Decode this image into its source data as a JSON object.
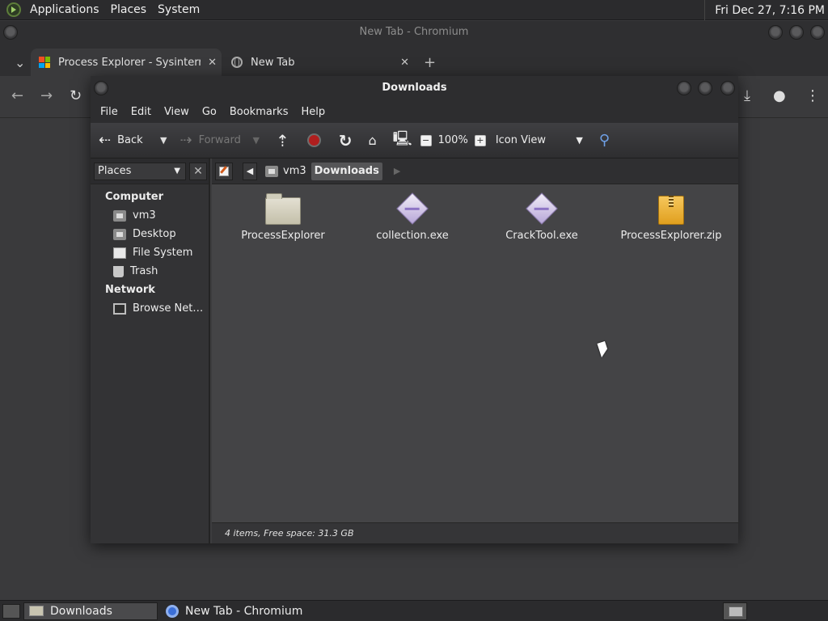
{
  "top_panel": {
    "menus": [
      "Applications",
      "Places",
      "System"
    ],
    "clock": "Fri Dec 27,  7:16 PM"
  },
  "chromium": {
    "window_title": "New Tab - Chromium",
    "tabs": [
      {
        "label": "Process Explorer - Sysinterna",
        "close": "✕",
        "icon": "microsoft-icon"
      },
      {
        "label": "New Tab",
        "close": "✕",
        "icon": "globe-icon"
      }
    ],
    "new_tab": "+",
    "tab_list": "⌄"
  },
  "file_manager": {
    "title": "Downloads",
    "menu": [
      "File",
      "Edit",
      "View",
      "Go",
      "Bookmarks",
      "Help"
    ],
    "toolbar": {
      "back": "Back",
      "forward": "Forward",
      "zoom": "100%",
      "view_mode": "Icon View"
    },
    "sidebar": {
      "selector": "Places",
      "groups": [
        {
          "label": "Computer",
          "items": [
            {
              "label": "vm3",
              "icon": "home-icon"
            },
            {
              "label": "Desktop",
              "icon": "desktop-icon"
            },
            {
              "label": "File System",
              "icon": "filesystem-icon"
            },
            {
              "label": "Trash",
              "icon": "trash-icon"
            }
          ]
        },
        {
          "label": "Network",
          "items": [
            {
              "label": "Browse Net…",
              "icon": "network-icon"
            }
          ]
        }
      ]
    },
    "pathbar": {
      "crumbs": [
        "vm3",
        "Downloads"
      ]
    },
    "files": [
      {
        "name": "ProcessExplorer",
        "type": "folder"
      },
      {
        "name": "collection.exe",
        "type": "exe"
      },
      {
        "name": "CrackTool.exe",
        "type": "exe"
      },
      {
        "name": "ProcessExplorer.zip",
        "type": "zip"
      }
    ],
    "status": "4 items, Free space: 31.3 GB"
  },
  "taskbar": {
    "tasks": [
      {
        "label": "Downloads",
        "icon": "folder-icon",
        "active": true
      },
      {
        "label": "New Tab - Chromium",
        "icon": "chromium-icon",
        "active": false
      }
    ]
  },
  "colors": {
    "panel_bg": "#2b2b2d",
    "window_bg": "#3c3c3e",
    "stop_red": "#b01e1e",
    "zip_orange": "#e09f1e"
  }
}
